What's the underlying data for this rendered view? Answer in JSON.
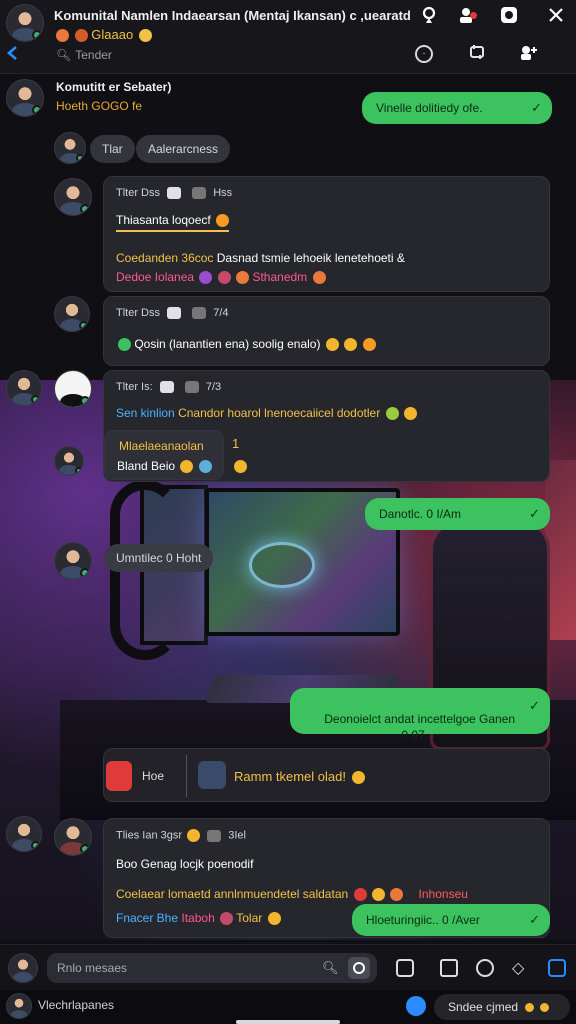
{
  "header": {
    "title": "Komunital Namlen Indaearsan (Mentaj Ikansan) c ,uearatdc",
    "subtitle": "Glaaao",
    "back_icon": "back-arrow-icon",
    "search_text": "Tender"
  },
  "group_row": {
    "name": "Komutitt er Sebater)",
    "sub": "Hoeth GOGO fe"
  },
  "messages": {
    "out_1": "Vinelle dolitiedy ofe.",
    "pill_a": "Tlar",
    "pill_b": "Aalerarcness",
    "m1_head_name": "Tlter Dss",
    "m1_head_meta": "Hss",
    "m1_quote": "Thiasanta loqoecf",
    "m1_line1": "Coedanden 36coc",
    "m1_line1b": "Dasnad tsmie lehoeik lenetehoeti &",
    "m1_line2": "Dedoe Iolanea",
    "m1_line2b": "Sthanedm",
    "m2_head_name": "Tlter Dss",
    "m2_head_meta": "7/4",
    "m2_line": "Qosin (lanantien ena) soolig enalo)",
    "m3_head_name": "Tlter Is:",
    "m3_head_meta": "7/3",
    "m3_line1a": "Sen kinlion",
    "m3_line1b": "Cnandor hoarol lnenoecaiicel dodotler",
    "m3_quote": "Mlaelaeanaolan",
    "m3_quote_mark": "1",
    "m3_line2": "Bland Beio",
    "m4_pill": "Umntilec 0 Hoht",
    "out_2": "Danotlc. 0 I/Am",
    "out_3": "Deonoielct andat incettelgoe Ganen\n0 07",
    "reply_label": "Hoe",
    "reply_text": "Ramm tkemel olad!",
    "m5_head_name": "Tlies Ian 3gsr",
    "m5_head_meta": "3Iel",
    "m5_line1": "Boo Genag locjk poenodif",
    "m5_line2": "Coelaear lomaetd annlnmuendetel saldatan",
    "m5_line2b": "Inhonseu",
    "m5_line3a": "Fnacer Bhe",
    "m5_line3b": "Itaboh",
    "m5_line3c": "Tolar",
    "out_4": "Hloeturingiic.. 0 /Aver"
  },
  "input": {
    "placeholder": "Rnlo mesaes"
  },
  "footer": {
    "left_text": "Vlechrlapanes",
    "right_text": "Sndee cjmed"
  },
  "colors": {
    "accent_green": "#3cc25e",
    "accent_blue": "#2a8cff",
    "yellow_text": "#f2c247",
    "orange_text": "#e7a936",
    "pink_text": "#ff5a8a",
    "cyan_text": "#4cb4ff"
  }
}
